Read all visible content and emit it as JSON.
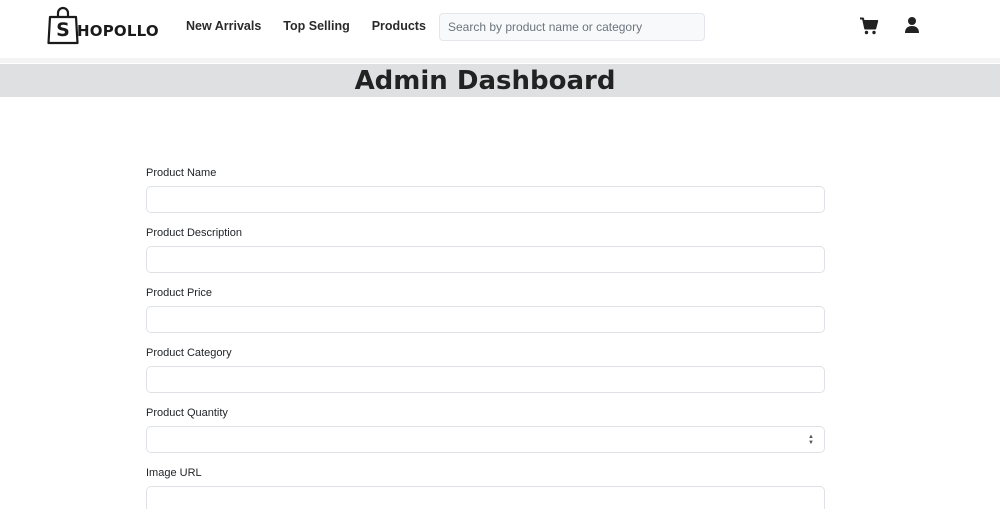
{
  "brand": {
    "logo_letter": "S",
    "logo_rest": "HOPOLLO"
  },
  "nav": {
    "links": [
      {
        "label": "New Arrivals"
      },
      {
        "label": "Top Selling"
      },
      {
        "label": "Products"
      }
    ],
    "search_placeholder": "Search by product name or category",
    "icons": {
      "cart": "cart-icon",
      "user": "user-icon"
    }
  },
  "page": {
    "title": "Admin Dashboard"
  },
  "form": {
    "fields": [
      {
        "label": "Product Name",
        "value": ""
      },
      {
        "label": "Product Description",
        "value": ""
      },
      {
        "label": "Product Price",
        "value": ""
      },
      {
        "label": "Product Category",
        "value": ""
      },
      {
        "label": "Product Quantity",
        "value": "",
        "type": "number"
      },
      {
        "label": "Image URL",
        "value": ""
      }
    ]
  },
  "colors": {
    "banner": "#dfe0e2",
    "text": "#212529",
    "input_border": "#dee2e6"
  }
}
